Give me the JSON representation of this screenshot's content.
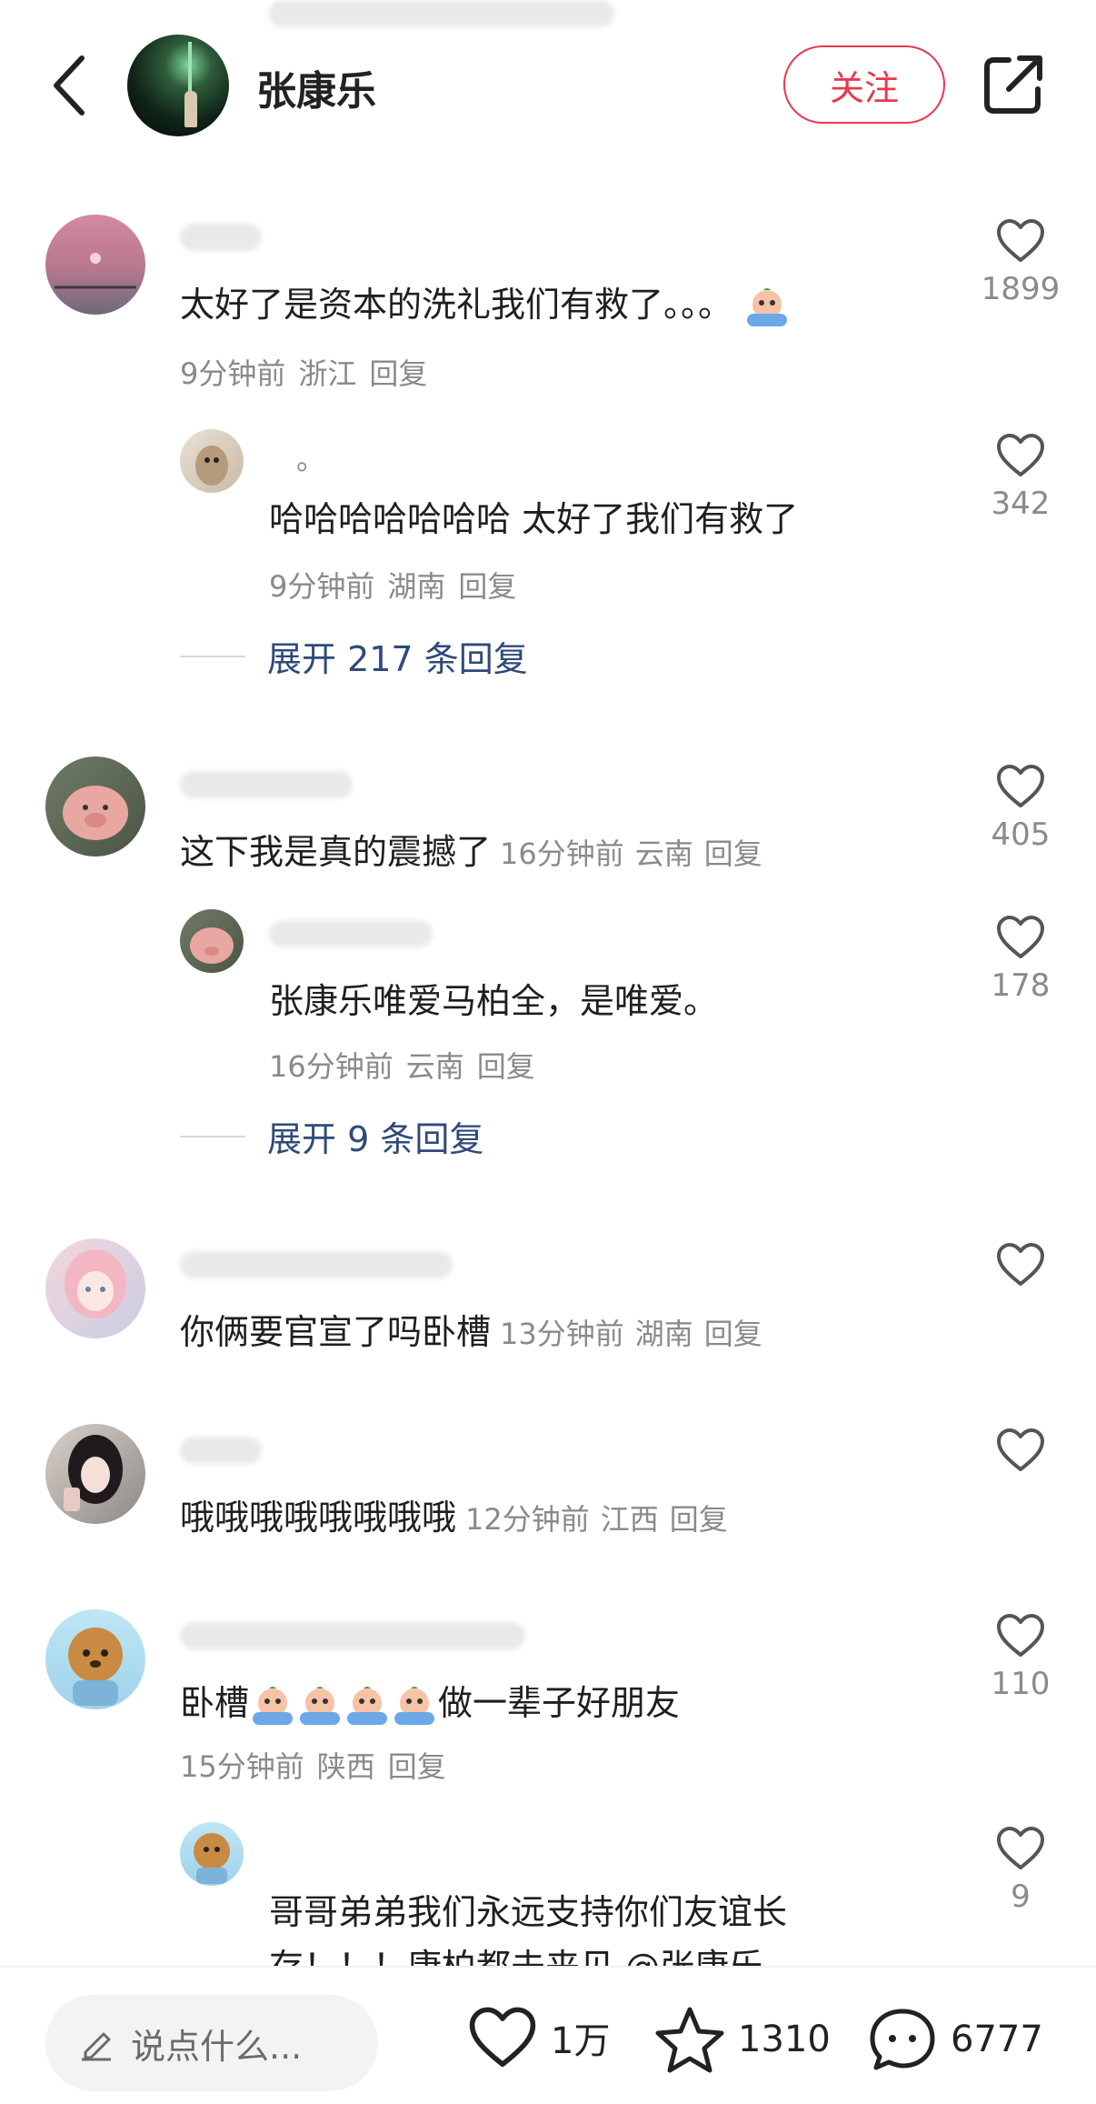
{
  "header": {
    "title": "张康乐",
    "follow_label": "关注"
  },
  "comments": [
    {
      "text": "太好了是资本的洗礼我们有救了。。。",
      "time": "9分钟前",
      "location": "浙江",
      "reply_label": "回复",
      "likes": "1899"
    },
    {
      "name": "。",
      "text": "哈哈哈哈哈哈哈 太好了我们有救了",
      "time": "9分钟前",
      "location": "湖南",
      "reply_label": "回复",
      "likes": "342"
    },
    {
      "text": "这下我是真的震撼了",
      "time": "16分钟前",
      "location": "云南",
      "reply_label": "回复",
      "likes": "405"
    },
    {
      "text": "张康乐唯爱马柏全，是唯爱。",
      "time": "16分钟前",
      "location": "云南",
      "reply_label": "回复",
      "likes": "178"
    },
    {
      "text": "你俩要官宣了吗卧槽",
      "time": "13分钟前",
      "location": "湖南",
      "reply_label": "回复",
      "likes": ""
    },
    {
      "text": "哦哦哦哦哦哦哦哦",
      "time": "12分钟前",
      "location": "江西",
      "reply_label": "回复",
      "likes": ""
    },
    {
      "text_prefix": "卧槽",
      "text_suffix": "做一辈子好朋友",
      "time": "15分钟前",
      "location": "陕西",
      "reply_label": "回复",
      "likes": "110"
    },
    {
      "text": "哥哥弟弟我们永远支持你们友谊长",
      "text_line2": "存！！！康柏都未来见 @张康乐",
      "likes": "9"
    }
  ],
  "expand_replies": [
    "展开 217 条回复",
    "展开 9 条回复"
  ],
  "bottom_bar": {
    "input_placeholder": "说点什么...",
    "like_count": "1万",
    "favorite_count": "1310",
    "comment_count": "6777"
  },
  "colors": {
    "accent_red": "#e8384f",
    "link_blue": "#2f4a7a",
    "meta_gray": "#8a8a8a"
  },
  "icons": [
    "back-arrow-icon",
    "share-icon",
    "heart-icon",
    "star-icon",
    "comment-icon",
    "pencil-icon",
    "crying-emoji-icon"
  ]
}
